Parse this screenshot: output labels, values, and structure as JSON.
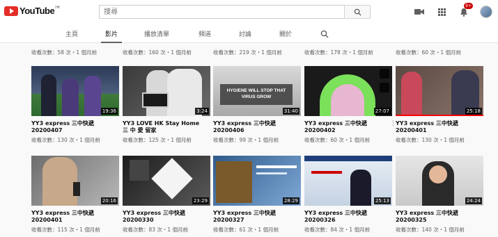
{
  "masthead": {
    "logo_text": "YouTube",
    "logo_country": "HK",
    "search_placeholder": "搜尋",
    "notification_count": "9+"
  },
  "tabs": [
    {
      "label": "主頁"
    },
    {
      "label": "影片"
    },
    {
      "label": "播放清單"
    },
    {
      "label": "頻道"
    },
    {
      "label": "討論"
    },
    {
      "label": "關於"
    }
  ],
  "previous_row_meta": [
    "收看次數：58 次・1 個月前",
    "收看次數：160 次・1 個月前",
    "收看次數：219 次・1 個月前",
    "收看次數：178 次・1 個月前",
    "收看次數：60 次・1 個月前"
  ],
  "videos_row1": [
    {
      "title": "YY3 express 三中快遞 20200407",
      "meta": "收看次數：130 次・1 個月前",
      "duration": "19:36"
    },
    {
      "title": "YY3 LOVE HK Stay Home 三 中 愛 留家",
      "meta": "收看次數：125 次・1 個月前",
      "duration": "3:24"
    },
    {
      "title": "YY3 express 三中快遞 20200406",
      "meta": "收看次數：99 次・1 個月前",
      "duration": "31:40",
      "thumb_text": "HYGIENE WILL STOP THAT VIRUS GROW"
    },
    {
      "title": "YY3 express 三中快遞 20200402",
      "meta": "收看次數：60 次・1 個月前",
      "duration": "27:07"
    },
    {
      "title": "YY3 express 三中快遞 20200401",
      "meta": "收看次數：130 次・1 個月前",
      "duration": "25:18"
    }
  ],
  "videos_row2": [
    {
      "title": "YY3 express 三中快遞 20200401",
      "meta": "收看次數：115 次・1 個月前",
      "duration": "20:16"
    },
    {
      "title": "YY3 express 三中快遞 20200330",
      "meta": "收看次數：83 次・1 個月前",
      "duration": "23:29"
    },
    {
      "title": "YY3 express 三中快遞 20200327",
      "meta": "收看次數：61 次・1 個月前",
      "duration": "28:29"
    },
    {
      "title": "YY3 express 三中快遞 20200326",
      "meta": "收看次數：84 次・1 個月前",
      "duration": "25:13"
    },
    {
      "title": "YY3 express 三中快遞 20200325",
      "meta": "收看次數：140 次・1 個月前",
      "duration": "24:24"
    }
  ]
}
